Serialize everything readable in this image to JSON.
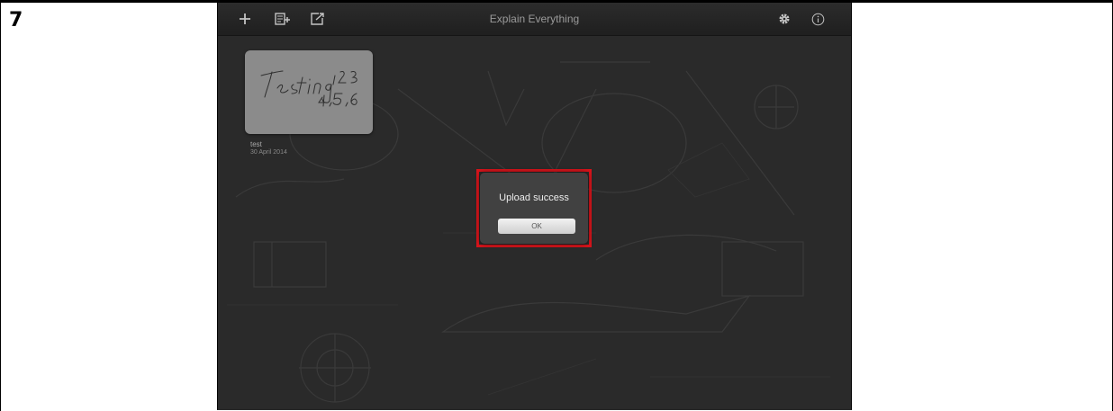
{
  "step": {
    "number": "7"
  },
  "app": {
    "title": "Explain Everything",
    "toolbar_icons": [
      "plus-icon",
      "new-slide-icon",
      "export-icon",
      "gear-icon",
      "info-icon"
    ]
  },
  "project": {
    "name": "test",
    "date": "30 April 2014",
    "thumbnail_text": "Testing 1,2,3 4,5,6"
  },
  "alert": {
    "message": "Upload success",
    "ok_label": "OK"
  },
  "colors": {
    "highlight": "#d7141b",
    "background": "#2a2a2a"
  }
}
